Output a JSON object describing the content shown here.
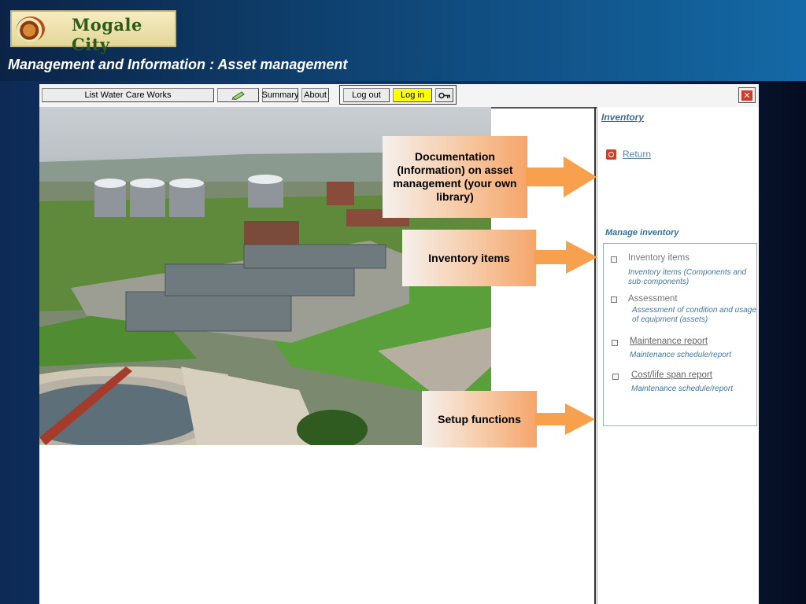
{
  "brand": {
    "logo_text": "Mogale City"
  },
  "page": {
    "subtitle": "Management and Information : Asset management"
  },
  "toolbar": {
    "list_label": "List Water Care Works",
    "summary_label": "Summary",
    "about_label": "About",
    "logout_label": "Log out",
    "login_label": "Log in",
    "close_glyph": "✕"
  },
  "sidebar": {
    "title": "Inventory",
    "return_label": "Return",
    "manage_title": "Manage inventory",
    "items": [
      {
        "label": "Inventory items",
        "desc": "Inventory items (Components and sub-components)"
      },
      {
        "label": "Assessment",
        "desc": "Assessment of condition and usage of equipment (assets)"
      },
      {
        "label": "Maintenance report",
        "desc": "Maintenance schedule/report"
      },
      {
        "label": "Cost/life span report",
        "desc": "Maintenance schedule/report"
      }
    ]
  },
  "callouts": {
    "documentation": "Documentation (Information) on asset management (your own library)",
    "inventory": "Inventory items",
    "setup": "Setup functions"
  },
  "colors": {
    "accent_link": "#356f9a",
    "login_highlight": "#ffff00",
    "callout_orange": "#f6a56a",
    "arrow_orange": "#f7a04d"
  }
}
